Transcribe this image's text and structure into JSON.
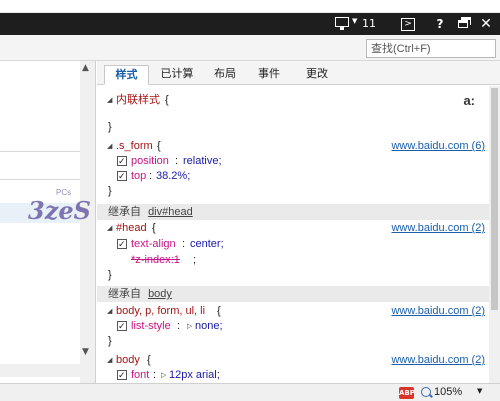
{
  "titlebar": {
    "target_number": "11",
    "console_glyph": ">",
    "help_glyph": "?",
    "close_glyph": "✕"
  },
  "find": {
    "placeholder": "查找(Ctrl+F)"
  },
  "tabs": [
    {
      "label": "样式",
      "active": true
    },
    {
      "label": "已计算"
    },
    {
      "label": "布局"
    },
    {
      "label": "事件"
    },
    {
      "label": "更改"
    }
  ],
  "rules": {
    "inline": {
      "selector": "内联样式",
      "open": "{",
      "close": "}",
      "aa": "a:"
    },
    "s_form": {
      "selector": ".s_form",
      "open": "{",
      "close": "}",
      "source": "www.baidu.com (6)",
      "decls": [
        {
          "prop": "position",
          "value": "relative;"
        },
        {
          "prop": "top",
          "value": "38.2%;"
        }
      ]
    },
    "inherit1": {
      "prefix": "继承自",
      "link": "div#head"
    },
    "head": {
      "selector": "#head",
      "open": "{",
      "close": "}",
      "source": "www.baidu.com (2)",
      "decls": [
        {
          "prop": "text-align",
          "value": "center;"
        }
      ],
      "struck_prop": "*z-index:1",
      "struck_val": ";"
    },
    "inherit2": {
      "prefix": "继承自",
      "link": "body"
    },
    "body_list": {
      "selector": "body, p, form, ul, li",
      "open": "{",
      "close": "}",
      "source": "www.baidu.com (2)",
      "decls": [
        {
          "prop": "list-style",
          "value": "none;"
        }
      ]
    },
    "body": {
      "selector": "body",
      "open": "{",
      "source": "www.baidu.com (2)",
      "decls": [
        {
          "prop": "font",
          "value": "12px arial;"
        }
      ]
    }
  },
  "status": {
    "abp": "ABP",
    "zoom": "105%"
  },
  "watermark": {
    "text": "3zeS",
    "small": "PCs"
  }
}
